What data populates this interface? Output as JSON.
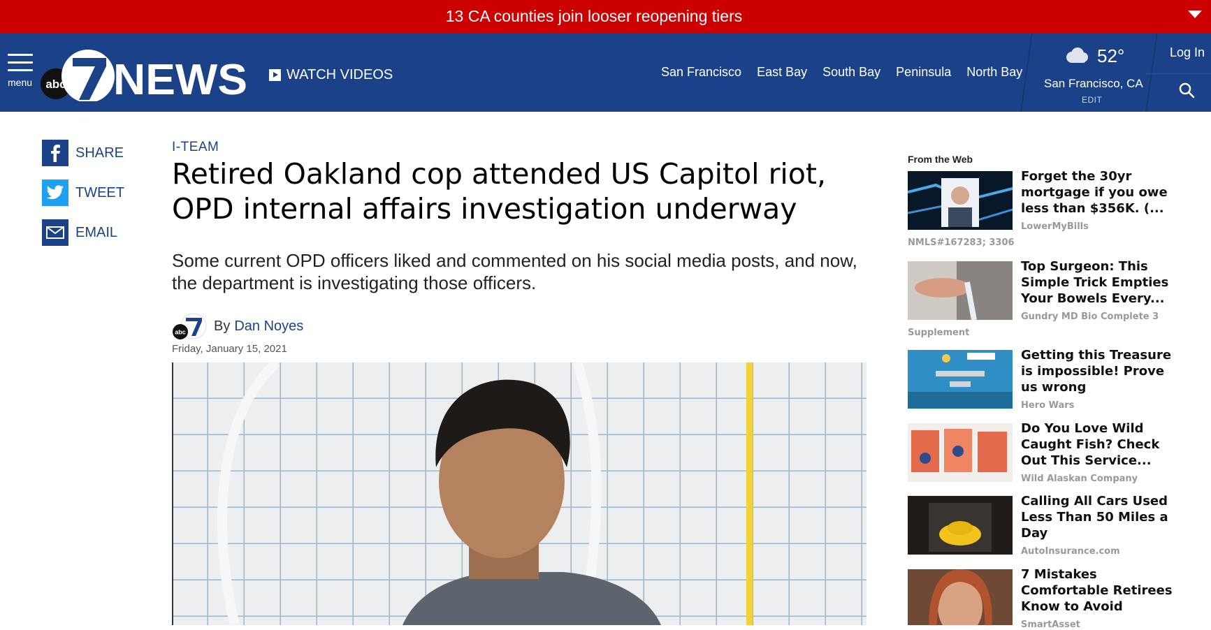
{
  "alert": {
    "text": "13 CA counties join looser reopening tiers"
  },
  "header": {
    "menu_label": "menu",
    "logo_text": "abc7NEWS",
    "watch_videos": "WATCH VIDEOS",
    "nav": [
      "San Francisco",
      "East Bay",
      "South Bay",
      "Peninsula",
      "North Bay"
    ],
    "weather": {
      "temp": "52°",
      "location": "San Francisco, CA",
      "edit": "EDIT",
      "icon": "cloud-icon"
    },
    "login": "Log In",
    "colors": {
      "brand_blue": "#1b4288",
      "alert_red": "#cc0000"
    }
  },
  "share": [
    {
      "label": "SHARE",
      "icon": "facebook-icon"
    },
    {
      "label": "TWEET",
      "icon": "twitter-icon"
    },
    {
      "label": "EMAIL",
      "icon": "email-icon"
    }
  ],
  "article": {
    "kicker": "I-TEAM",
    "headline": "Retired Oakland cop attended US Capitol riot, OPD internal affairs investigation underway",
    "dek": "Some current OPD officers liked and commented on his social media posts, and now, the department is investigating those officers.",
    "by": "By",
    "author": "Dan Noyes",
    "date": "Friday, January 15, 2021"
  },
  "sidebar": {
    "title": "From the Web",
    "items": [
      {
        "title": "Forget the 30yr mortgage if you owe less than $356K. (...",
        "source": "LowerMyBills",
        "source_extra": "NMLS#167283; 3306"
      },
      {
        "title": "Top Surgeon: This Simple Trick Empties Your Bowels Every...",
        "source": "Gundry MD Bio Complete 3",
        "source_extra": "Supplement"
      },
      {
        "title": "Getting this Treasure is impossible! Prove us wrong",
        "source": "Hero Wars"
      },
      {
        "title": "Do You Love Wild Caught Fish? Check Out This Service...",
        "source": "Wild Alaskan Company"
      },
      {
        "title": "Calling All Cars Used Less Than 50 Miles a Day",
        "source": "AutoInsurance.com"
      },
      {
        "title": "7 Mistakes Comfortable Retirees Know to Avoid",
        "source": "SmartAsset"
      }
    ]
  }
}
